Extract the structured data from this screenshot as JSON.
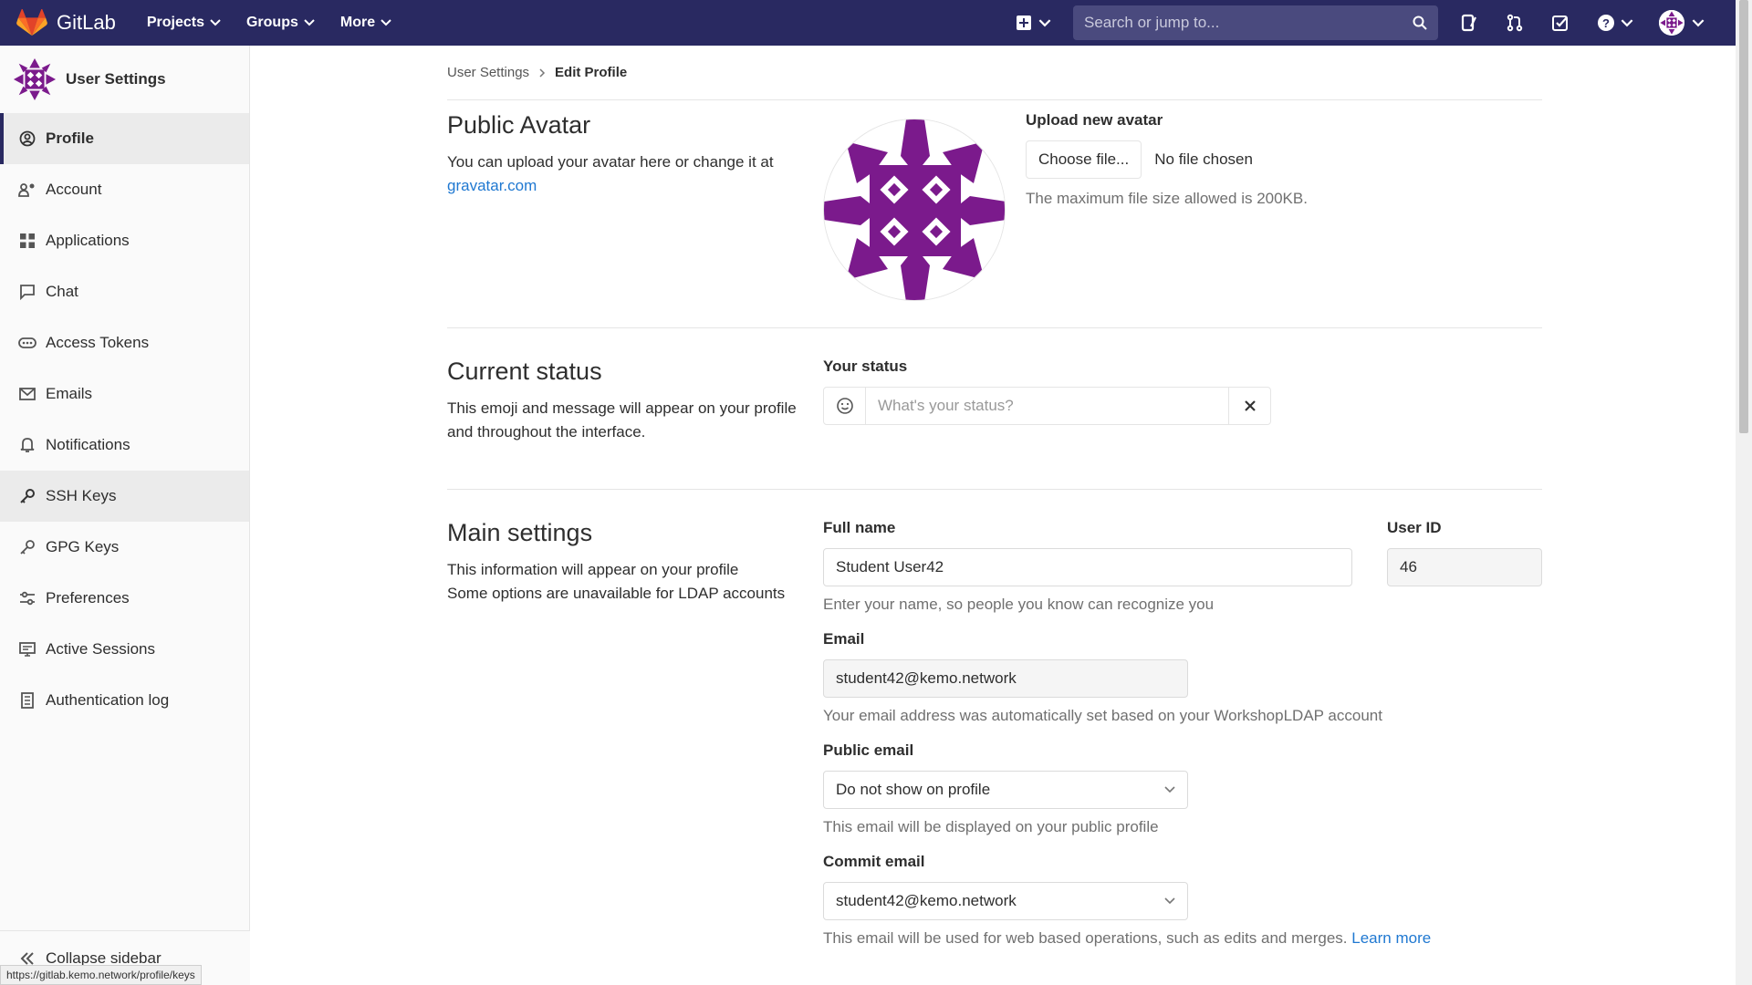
{
  "navbar": {
    "brand": "GitLab",
    "menu": [
      {
        "label": "Projects"
      },
      {
        "label": "Groups"
      },
      {
        "label": "More"
      }
    ],
    "search_placeholder": "Search or jump to..."
  },
  "sidebar": {
    "context_title": "User Settings",
    "items": [
      {
        "label": "Profile",
        "icon": "profile-icon"
      },
      {
        "label": "Account",
        "icon": "account-icon"
      },
      {
        "label": "Applications",
        "icon": "applications-icon"
      },
      {
        "label": "Chat",
        "icon": "chat-icon"
      },
      {
        "label": "Access Tokens",
        "icon": "token-icon"
      },
      {
        "label": "Emails",
        "icon": "email-icon"
      },
      {
        "label": "Notifications",
        "icon": "bell-icon"
      },
      {
        "label": "SSH Keys",
        "icon": "key-icon"
      },
      {
        "label": "GPG Keys",
        "icon": "key-icon"
      },
      {
        "label": "Preferences",
        "icon": "preferences-icon"
      },
      {
        "label": "Active Sessions",
        "icon": "monitor-icon"
      },
      {
        "label": "Authentication log",
        "icon": "log-icon"
      }
    ],
    "collapse_label": "Collapse sidebar",
    "status_url": "https://gitlab.kemo.network/profile/keys"
  },
  "breadcrumb": {
    "parent": "User Settings",
    "current": "Edit Profile"
  },
  "avatar_section": {
    "title": "Public Avatar",
    "desc": "You can upload your avatar here or change it at",
    "link": "gravatar.com",
    "upload_label": "Upload new avatar",
    "choose_button": "Choose file...",
    "file_status": "No file chosen",
    "help": "The maximum file size allowed is 200KB."
  },
  "status_section": {
    "title": "Current status",
    "desc": "This emoji and message will appear on your profile and throughout the interface.",
    "label": "Your status",
    "placeholder": "What's your status?"
  },
  "main_section": {
    "title": "Main settings",
    "desc_line1": "This information will appear on your profile",
    "desc_line2": "Some options are unavailable for LDAP accounts",
    "full_name_label": "Full name",
    "full_name_value": "Student User42",
    "full_name_help": "Enter your name, so people you know can recognize you",
    "user_id_label": "User ID",
    "user_id_value": "46",
    "email_label": "Email",
    "email_value": "student42@kemo.network",
    "email_help": "Your email address was automatically set based on your WorkshopLDAP account",
    "public_email_label": "Public email",
    "public_email_value": "Do not show on profile",
    "public_email_help": "This email will be displayed on your public profile",
    "commit_email_label": "Commit email",
    "commit_email_value": "student42@kemo.network",
    "commit_email_help": "This email will be used for web based operations, such as edits and merges.",
    "learn_more": "Learn more"
  },
  "colors": {
    "navbar": "#292961",
    "link": "#1f78d1",
    "avatar_purple": "#7b1a8c"
  }
}
